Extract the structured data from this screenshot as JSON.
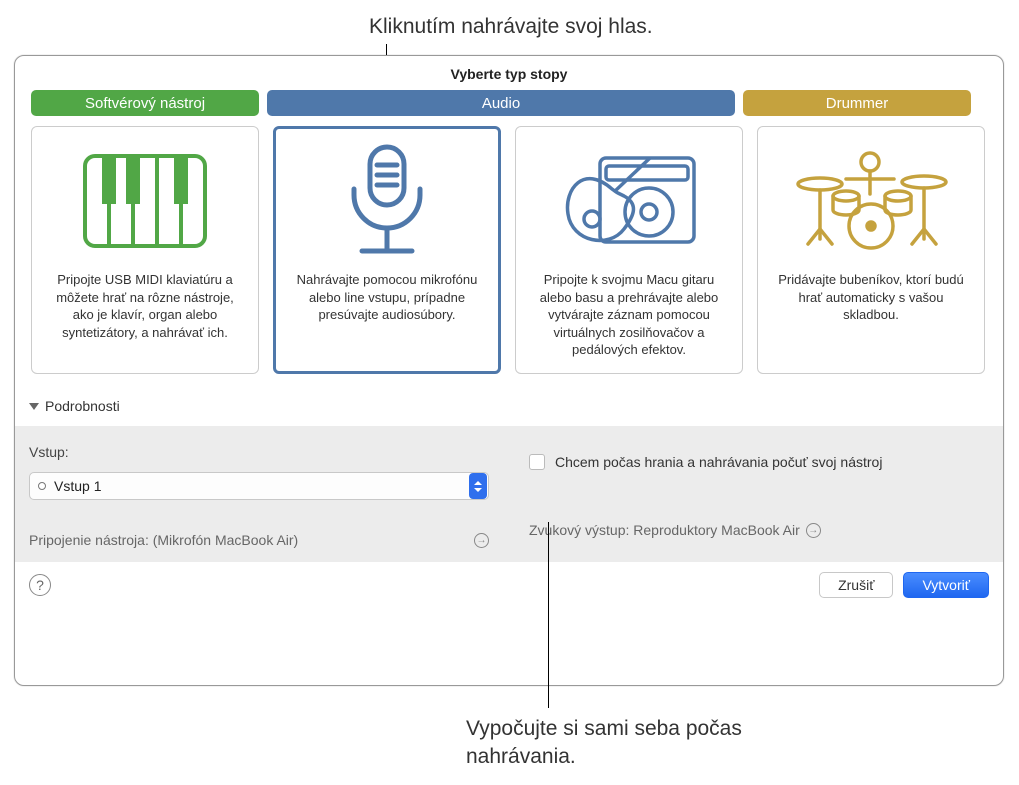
{
  "annotations": {
    "top": "Kliknutím nahrávajte svoj hlas.",
    "bottom": "Vypočujte si sami seba počas nahrávania."
  },
  "panel": {
    "title": "Vyberte typ stopy",
    "tabs": {
      "software": "Softvérový nástroj",
      "audio": "Audio",
      "drummer": "Drummer"
    },
    "cards": {
      "software": "Pripojte USB MIDI klaviatúru a môžete hrať na rôzne nástroje, ako je klavír, organ alebo syntetizátory, a nahrávať ich.",
      "mic": "Nahrávajte pomocou mikrofónu alebo line vstupu, prípadne presúvajte audiosúbory.",
      "guitar": "Pripojte k svojmu Macu gitaru alebo basu a prehrávajte alebo vytvárajte záznam pomocou virtuálnych zosilňovačov a pedálových efektov.",
      "drummer": "Pridávajte bubeníkov, ktorí budú hrať automaticky s vašou skladbou."
    },
    "details_label": "Podrobnosti",
    "input_label": "Vstup:",
    "input_value": "Vstup 1",
    "connection": "Pripojenie nástroja: (Mikrofón MacBook Air)",
    "monitor_checkbox": "Chcem počas hrania a nahrávania počuť svoj nástroj",
    "output": "Zvukový výstup: Reproduktory MacBook Air",
    "buttons": {
      "cancel": "Zrušiť",
      "create": "Vytvoriť"
    }
  }
}
